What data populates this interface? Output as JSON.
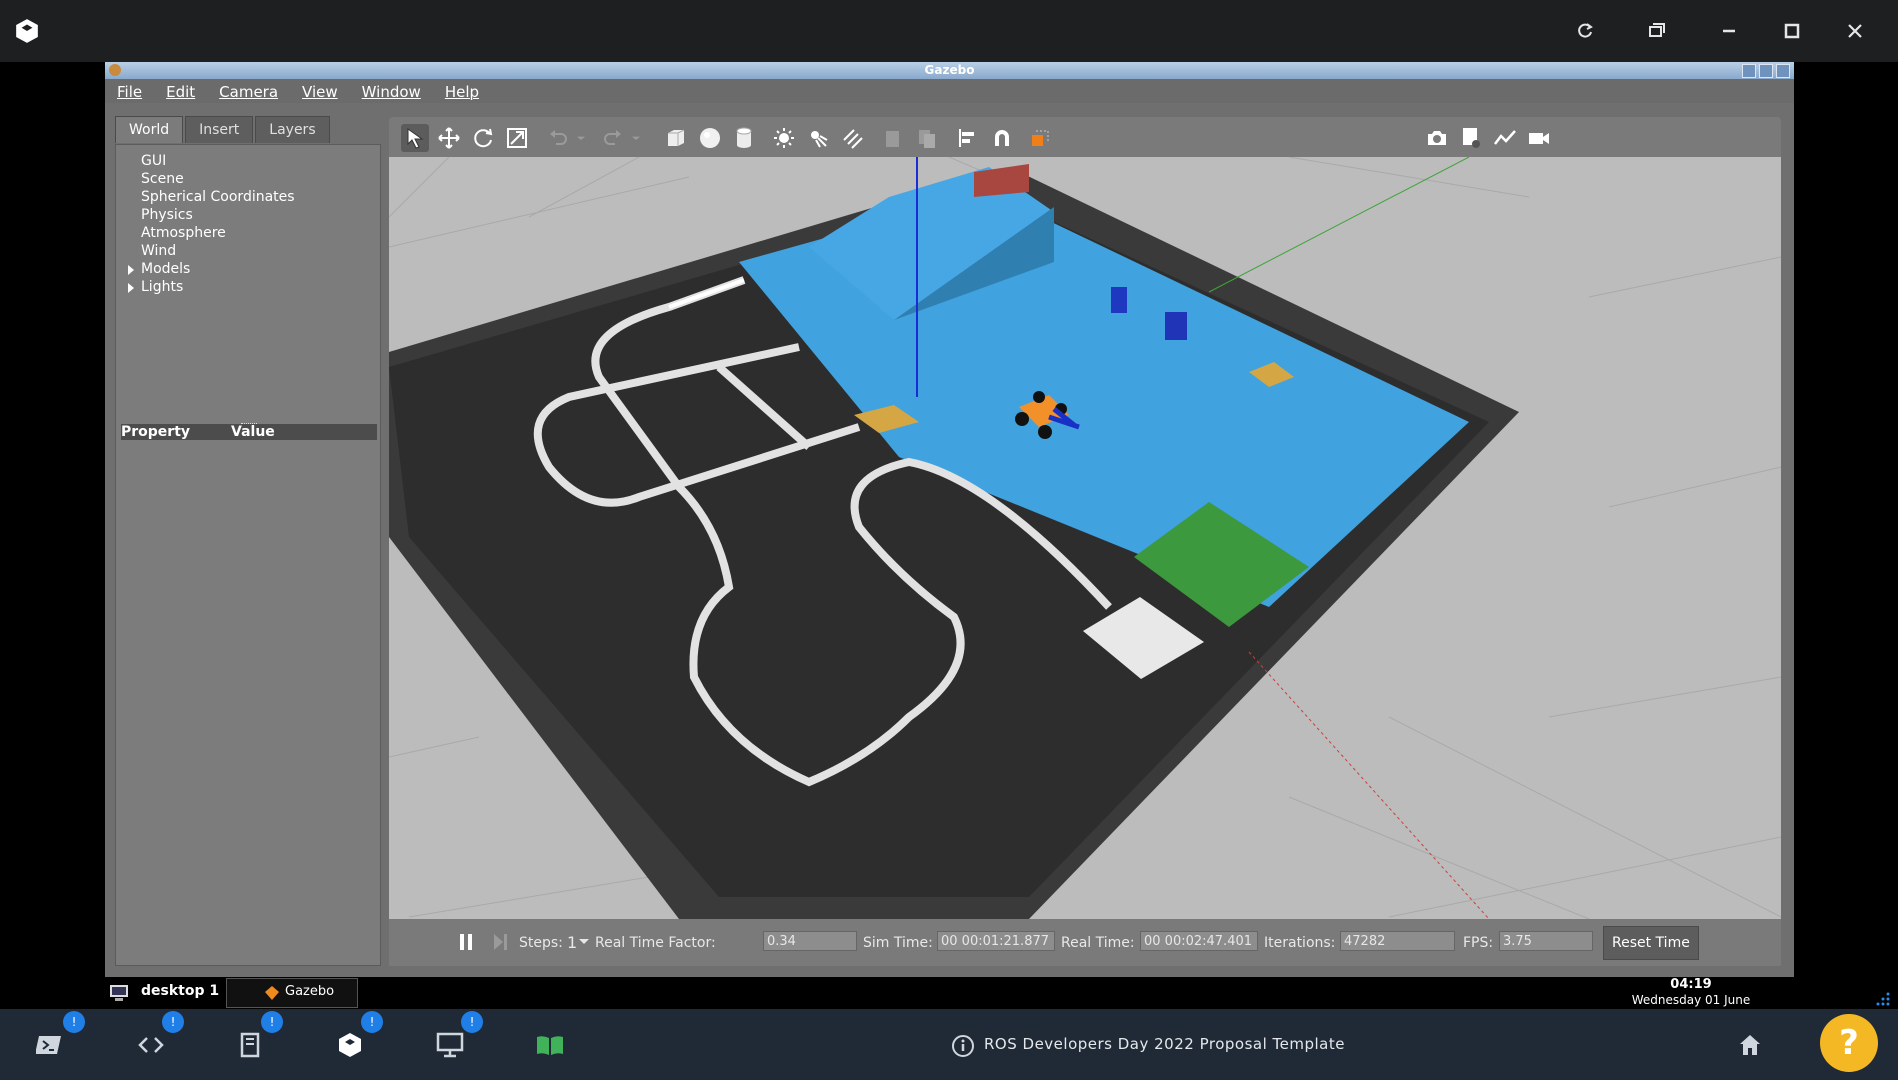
{
  "window_title": "Gazebo",
  "menu": [
    "File",
    "Edit",
    "Camera",
    "View",
    "Window",
    "Help"
  ],
  "left_tabs": [
    "World",
    "Insert",
    "Layers"
  ],
  "world_tree": [
    "GUI",
    "Scene",
    "Spherical Coordinates",
    "Physics",
    "Atmosphere",
    "Wind",
    "Models",
    "Lights"
  ],
  "property_header": {
    "property": "Property",
    "value": "Value"
  },
  "sim": {
    "steps_label": "Steps:",
    "steps_value": "1",
    "rtf_label": "Real Time Factor:",
    "rtf_value": "0.34",
    "sim_time_label": "Sim Time:",
    "sim_time_value": "00 00:01:21.877",
    "real_time_label": "Real Time:",
    "real_time_value": "00 00:02:47.401",
    "iterations_label": "Iterations:",
    "iterations_value": "47282",
    "fps_label": "FPS:",
    "fps_value": "3.75",
    "reset_label": "Reset Time"
  },
  "xbar": {
    "desktop": "desktop 1",
    "task": "Gazebo",
    "time": "04:19",
    "date": "Wednesday 01 June"
  },
  "dock": {
    "title": "ROS Developers Day 2022 Proposal Template",
    "badge": "!",
    "help": "?"
  },
  "colors": {
    "accent_blue": "#1f7fe6",
    "help_yellow": "#f5b825",
    "water_blue": "#3fa0dc",
    "track_dark": "#2c2c2c",
    "green_zone": "#3a9a3e"
  }
}
